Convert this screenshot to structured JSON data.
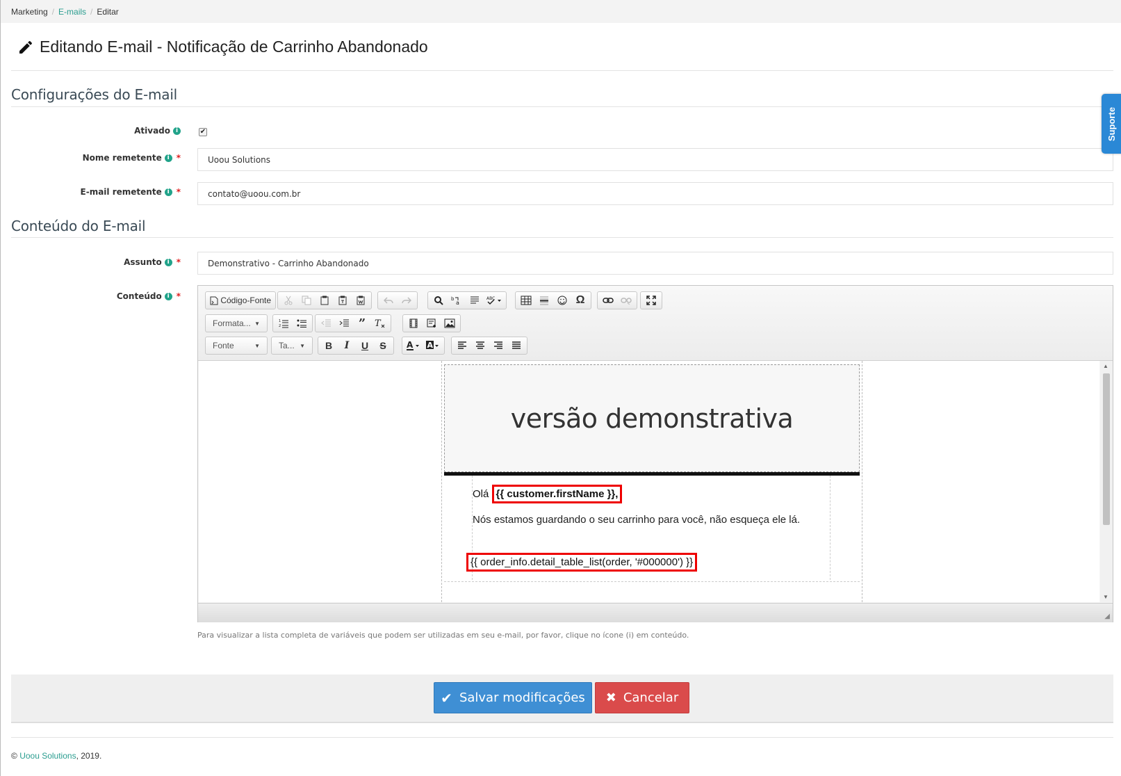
{
  "breadcrumb": {
    "item1": "Marketing",
    "item2": "E-mails",
    "item3": "Editar",
    "separator": "/"
  },
  "page": {
    "title": "Editando E-mail - Notificação de Carrinho Abandonado"
  },
  "sections": {
    "config": "Configurações do E-mail",
    "content": "Conteúdo do E-mail"
  },
  "fields": {
    "ativado": {
      "label": "Ativado",
      "checked": true,
      "check_glyph": "✔"
    },
    "nome": {
      "label": "Nome remetente",
      "value": "Uoou Solutions"
    },
    "email": {
      "label": "E-mail remetente",
      "value": "contato@uoou.com.br"
    },
    "assunto": {
      "label": "Assunto",
      "value": "Demonstrativo - Carrinho Abandonado"
    },
    "conteudo": {
      "label": "Conteúdo"
    }
  },
  "info_glyph": "i",
  "required_mark": "*",
  "editor": {
    "source_label": "Código-Fonte",
    "format_combo": "Formata...",
    "font_combo": "Fonte",
    "size_combo": "Ta...",
    "combo_arrow": "▼",
    "scroll_up": "▲",
    "scroll_down": "▼",
    "resize_glyph": "◢",
    "bold": "B",
    "italic": "I",
    "underline": "U",
    "strike": "S",
    "content": {
      "header_text": "versão demonstrativa",
      "greeting_prefix": "Olá ",
      "customer_var": "{{ customer.firstName }},",
      "body_text": "Nós estamos guardando o seu carrinho para você, não esqueça ele lá.",
      "order_var": "{{ order_info.detail_table_list(order, '#000000') }}"
    }
  },
  "help_text": "Para visualizar a lista completa de variáveis que podem ser utilizadas em seu e-mail, por favor, clique no ícone (i) em conteúdo.",
  "actions": {
    "save": "Salvar modificações",
    "save_glyph": "✔",
    "cancel": "Cancelar",
    "cancel_glyph": "✖"
  },
  "footer": {
    "prefix": "© ",
    "company": "Uoou Solutions",
    "suffix": ", 2019."
  },
  "support_tab": "Suporte",
  "colors": {
    "accent": "#2a9d8f",
    "save": "#3f8fd4",
    "cancel": "#da4b4b",
    "support": "#2a88d6",
    "highlight": "#e00000"
  }
}
